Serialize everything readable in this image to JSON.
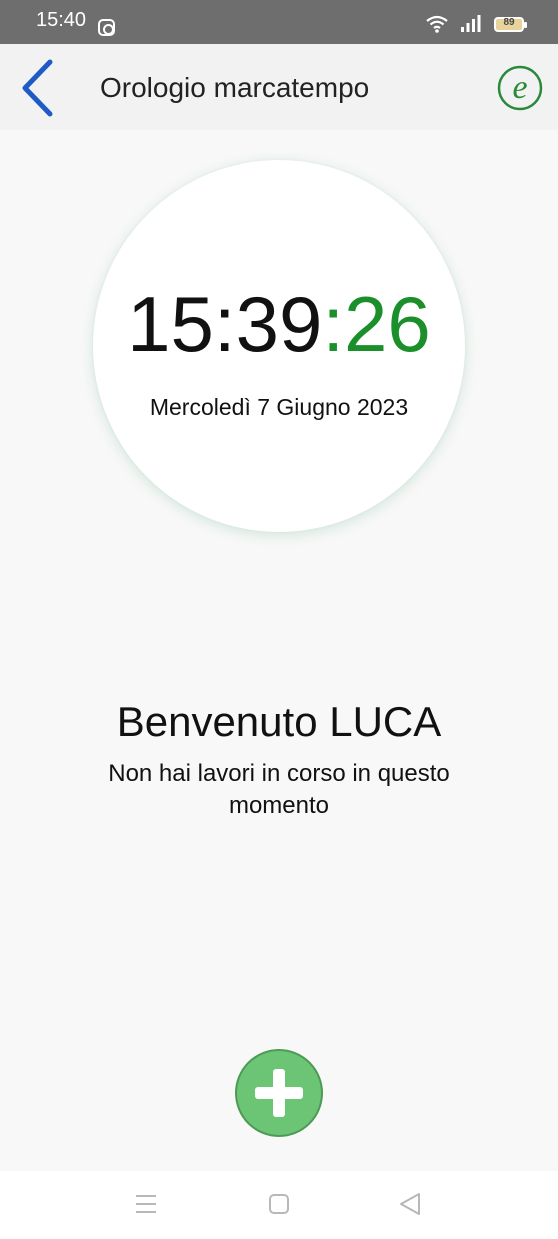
{
  "status_bar": {
    "time": "15:40",
    "battery": "89",
    "icons": [
      "instagram-icon",
      "wifi-icon",
      "signal-icon",
      "battery-icon"
    ]
  },
  "app_bar": {
    "title": "Orologio marcatempo",
    "back_icon": "chevron-left-icon",
    "logo_letter": "e",
    "accent": "#1e5bc6",
    "logo_color": "#2a8a3a"
  },
  "clock": {
    "hours_minutes": "15:39",
    "seconds": ":26",
    "date": "Mercoledì 7 Giugno 2023",
    "seconds_color": "#1a8f2a"
  },
  "welcome": {
    "title": "Benvenuto LUCA",
    "message": "Non hai lavori in corso in questo momento"
  },
  "fab": {
    "icon": "plus-icon",
    "color": "#6cc475"
  },
  "nav_bar": {
    "icons": [
      "menu-icon",
      "home-square-icon",
      "back-triangle-icon"
    ]
  }
}
